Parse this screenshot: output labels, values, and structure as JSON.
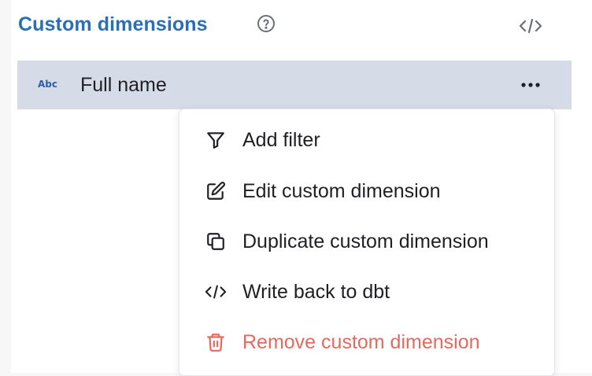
{
  "header": {
    "title": "Custom dimensions",
    "help_icon": "question-circle-icon",
    "code_icon": "code-icon"
  },
  "dimension": {
    "type_icon_text": "Abc",
    "label": "Full name",
    "more_icon": "dots-horizontal-icon"
  },
  "menu": {
    "items": [
      {
        "label": "Add filter",
        "icon": "filter-icon"
      },
      {
        "label": "Edit custom dimension",
        "icon": "edit-icon"
      },
      {
        "label": "Duplicate custom dimension",
        "icon": "copy-icon"
      },
      {
        "label": "Write back to dbt",
        "icon": "code-icon"
      },
      {
        "label": "Remove custom dimension",
        "icon": "trash-icon",
        "danger": true
      }
    ]
  },
  "colors": {
    "accent": "#2a6fb5",
    "row_highlight": "#d6dce7",
    "danger": "#e26a5e"
  }
}
